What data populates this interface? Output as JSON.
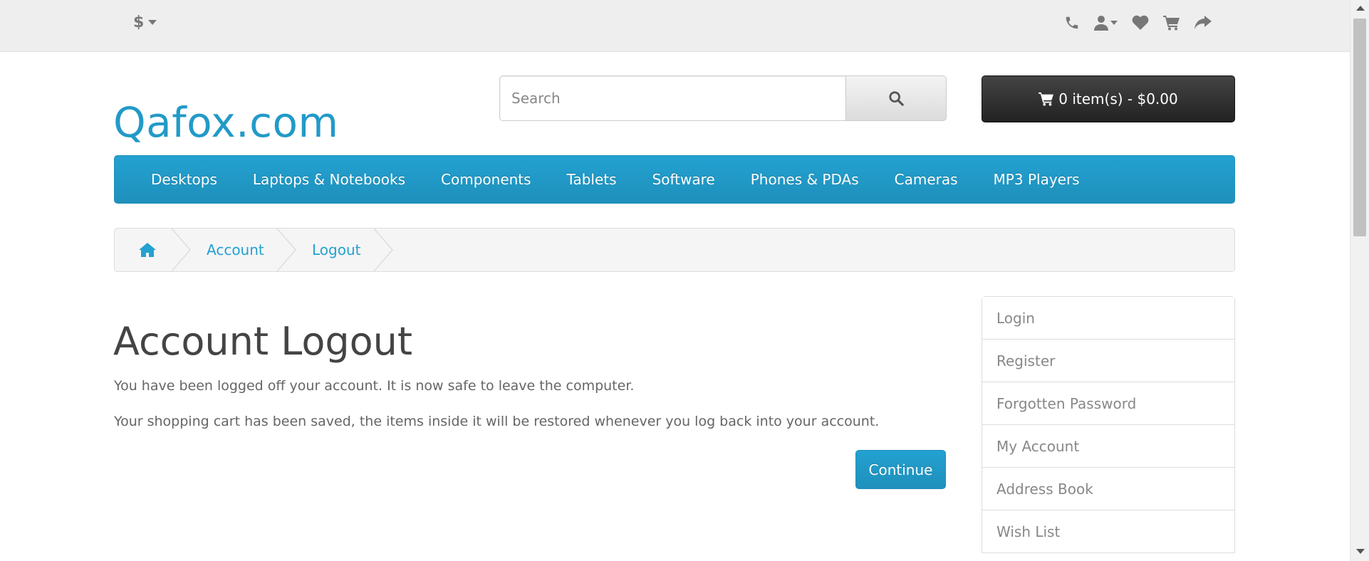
{
  "topbar": {
    "currency_symbol": "$",
    "icons": [
      "phone-icon",
      "user-icon",
      "heart-icon",
      "cart-icon",
      "share-icon"
    ]
  },
  "header": {
    "logo": "Qafox.com",
    "search_placeholder": "Search",
    "cart_label": "0 item(s) - $0.00"
  },
  "menu": {
    "items": [
      "Desktops",
      "Laptops & Notebooks",
      "Components",
      "Tablets",
      "Software",
      "Phones & PDAs",
      "Cameras",
      "MP3 Players"
    ]
  },
  "breadcrumb": {
    "items": [
      "Account",
      "Logout"
    ]
  },
  "content": {
    "title": "Account Logout",
    "paragraphs": [
      "You have been logged off your account. It is now safe to leave the computer.",
      "Your shopping cart has been saved, the items inside it will be restored whenever you log back into your account."
    ],
    "continue_label": "Continue"
  },
  "sidebar": {
    "items": [
      "Login",
      "Register",
      "Forgotten Password",
      "My Account",
      "Address Book",
      "Wish List"
    ]
  },
  "colors": {
    "accent": "#229ac8",
    "menu_bg": "#1f90bb",
    "cart_bg": "#333333",
    "topbar_bg": "#eeeeee"
  }
}
